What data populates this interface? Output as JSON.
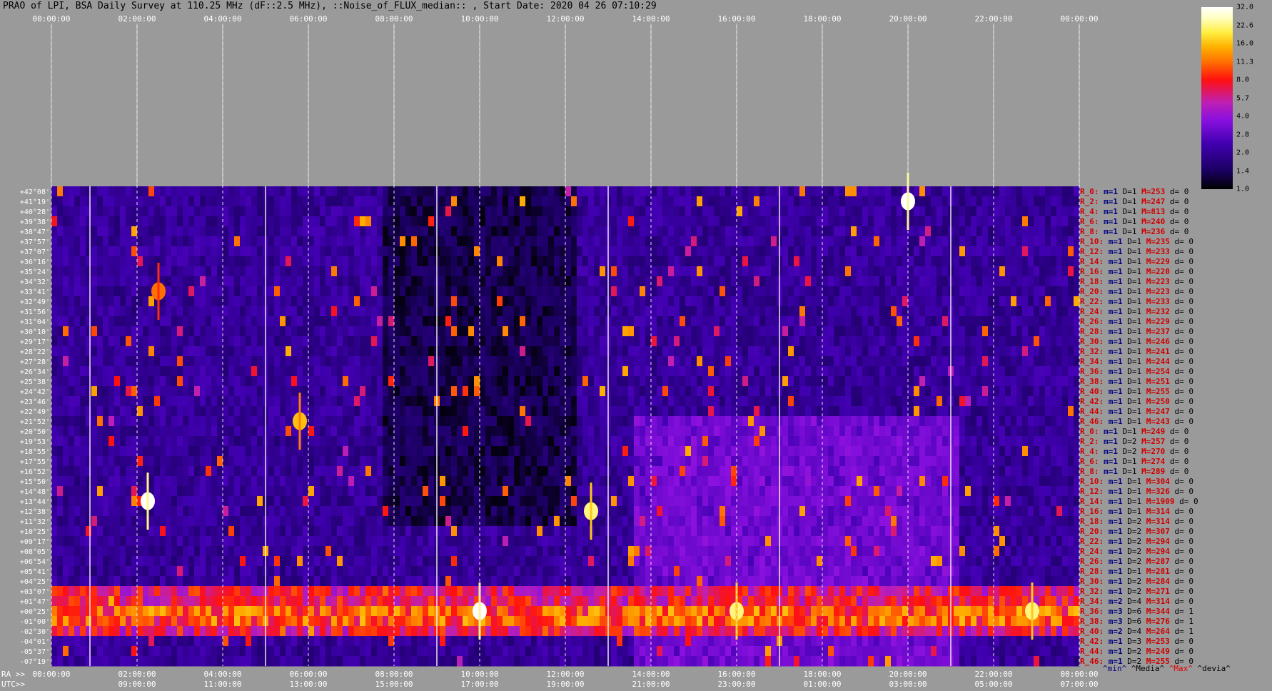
{
  "title": "PRAO of LPI, BSA Daily Survey at 110.25 MHz (dF::2.5 MHz), ::Noise_of_FLUX_median:: , Start Date: 2020 04 26 07:10:29",
  "chart_data": {
    "type": "heatmap",
    "title": "PRAO of LPI, BSA Daily Survey at 110.25 MHz (dF::2.5 MHz), ::Noise_of_FLUX_median:: , Start Date: 2020 04 26 07:10:29",
    "xlabel_ra": "RA >>",
    "xlabel_utc": "UTC>>",
    "x_ticks_ra_top": [
      "00:00:00",
      "02:00:00",
      "04:00:00",
      "06:00:00",
      "08:00:00",
      "10:00:00",
      "12:00:00",
      "14:00:00",
      "16:00:00",
      "18:00:00",
      "20:00:00",
      "22:00:00",
      "00:00:00"
    ],
    "x_ticks_ra_bottom": [
      "00:00:00",
      "02:00:00",
      "04:00:00",
      "06:00:00",
      "08:00:00",
      "10:00:00",
      "12:00:00",
      "14:00:00",
      "16:00:00",
      "18:00:00",
      "20:00:00",
      "22:00:00",
      "00:00:00"
    ],
    "x_ticks_utc": [
      "09:00:00",
      "11:00:00",
      "13:00:00",
      "15:00:00",
      "17:00:00",
      "19:00:00",
      "21:00:00",
      "23:00:00",
      "01:00:00",
      "03:00:00",
      "05:00:00",
      "07:00:00"
    ],
    "y_ticks": [
      "+42°08'",
      "+41°19'",
      "+40°28'",
      "+39°38'",
      "+38°47'",
      "+37°57'",
      "+37°07'",
      "+36°16'",
      "+35°24'",
      "+34°32'",
      "+33°41'",
      "+32°49'",
      "+31°56'",
      "+31°04'",
      "+30°10'",
      "+29°17'",
      "+28°22'",
      "+27°28'",
      "+26°34'",
      "+25°38'",
      "+24°42'",
      "+23°46'",
      "+22°49'",
      "+21°52'",
      "+20°50'",
      "+19°53'",
      "+18°55'",
      "+17°55'",
      "+16°52'",
      "+15°50'",
      "+14°48'",
      "+13°44'",
      "+12°38'",
      "+11°32'",
      "+10°25'",
      "+09°17'",
      "+08°05'",
      "+06°54'",
      "+05°41'",
      "+04°25'",
      "+03°07'",
      "+01°47'",
      "+00°25'",
      "-01°00'",
      "-02°30'",
      "-04°01'",
      "-05°37'",
      "-07°19'"
    ],
    "colorbar": {
      "ticks": [
        "32.0",
        "22.6",
        "16.0",
        "11.3",
        "8.0",
        "5.7",
        "4.0",
        "2.8",
        "2.0",
        "1.4",
        "1.0"
      ],
      "range": [
        1.0,
        32.0
      ],
      "scale": "log"
    },
    "bright_sources": [
      {
        "ra_h": 20.0,
        "dec": "+41°19'",
        "level": 32
      },
      {
        "ra_h": 2.25,
        "dec": "+13°44'",
        "level": 32
      },
      {
        "ra_h": 12.6,
        "dec": "+12°38'",
        "level": 22.6
      },
      {
        "ra_h": 5.8,
        "dec": "+21°52'",
        "level": 16
      },
      {
        "ra_h": 2.5,
        "dec": "+33°41'",
        "level": 11.3
      },
      {
        "ra_h": 16.0,
        "dec": "+00°25'",
        "level": 22.6
      },
      {
        "ra_h": 10.0,
        "dec": "+00°25'",
        "level": 32
      },
      {
        "ra_h": 22.9,
        "dec": "+00°25'",
        "level": 22.6
      }
    ],
    "row_stats": [
      {
        "label": "R_0:",
        "m": "m=1",
        "D": "D=1",
        "M": "M=253",
        "d": "d= 0"
      },
      {
        "label": "R_2:",
        "m": "m=1",
        "D": "D=1",
        "M": "M=247",
        "d": "d= 0"
      },
      {
        "label": "R_4:",
        "m": "m=1",
        "D": "D=1",
        "M": "M=813",
        "d": "d= 0"
      },
      {
        "label": "R_6:",
        "m": "m=1",
        "D": "D=1",
        "M": "M=240",
        "d": "d= 0"
      },
      {
        "label": "R_8:",
        "m": "m=1",
        "D": "D=1",
        "M": "M=236",
        "d": "d= 0"
      },
      {
        "label": "R_10:",
        "m": "m=1",
        "D": "D=1",
        "M": "M=235",
        "d": "d= 0"
      },
      {
        "label": "R_12:",
        "m": "m=1",
        "D": "D=1",
        "M": "M=233",
        "d": "d= 0"
      },
      {
        "label": "R_14:",
        "m": "m=1",
        "D": "D=1",
        "M": "M=229",
        "d": "d= 0"
      },
      {
        "label": "R_16:",
        "m": "m=1",
        "D": "D=1",
        "M": "M=220",
        "d": "d= 0"
      },
      {
        "label": "R_18:",
        "m": "m=1",
        "D": "D=1",
        "M": "M=223",
        "d": "d= 0"
      },
      {
        "label": "R_20:",
        "m": "m=1",
        "D": "D=1",
        "M": "M=223",
        "d": "d= 0"
      },
      {
        "label": "R_22:",
        "m": "m=1",
        "D": "D=1",
        "M": "M=233",
        "d": "d= 0"
      },
      {
        "label": "R_24:",
        "m": "m=1",
        "D": "D=1",
        "M": "M=232",
        "d": "d= 0"
      },
      {
        "label": "R_26:",
        "m": "m=1",
        "D": "D=1",
        "M": "M=229",
        "d": "d= 0"
      },
      {
        "label": "R_28:",
        "m": "m=1",
        "D": "D=1",
        "M": "M=237",
        "d": "d= 0"
      },
      {
        "label": "R_30:",
        "m": "m=1",
        "D": "D=1",
        "M": "M=246",
        "d": "d= 0"
      },
      {
        "label": "R_32:",
        "m": "m=1",
        "D": "D=1",
        "M": "M=241",
        "d": "d= 0"
      },
      {
        "label": "R_34:",
        "m": "m=1",
        "D": "D=1",
        "M": "M=244",
        "d": "d= 0"
      },
      {
        "label": "R_36:",
        "m": "m=1",
        "D": "D=1",
        "M": "M=254",
        "d": "d= 0"
      },
      {
        "label": "R_38:",
        "m": "m=1",
        "D": "D=1",
        "M": "M=251",
        "d": "d= 0"
      },
      {
        "label": "R_40:",
        "m": "m=1",
        "D": "D=1",
        "M": "M=255",
        "d": "d= 0"
      },
      {
        "label": "R_42:",
        "m": "m=1",
        "D": "D=1",
        "M": "M=250",
        "d": "d= 0"
      },
      {
        "label": "R_44:",
        "m": "m=1",
        "D": "D=1",
        "M": "M=247",
        "d": "d= 0"
      },
      {
        "label": "R_46:",
        "m": "m=1",
        "D": "D=1",
        "M": "M=243",
        "d": "d= 0"
      },
      {
        "label": "R_0:",
        "m": "m=1",
        "D": "D=1",
        "M": "M=249",
        "d": "d= 0"
      },
      {
        "label": "R_2:",
        "m": "m=1",
        "D": "D=2",
        "M": "M=257",
        "d": "d= 0"
      },
      {
        "label": "R_4:",
        "m": "m=1",
        "D": "D=2",
        "M": "M=270",
        "d": "d= 0"
      },
      {
        "label": "R_6:",
        "m": "m=1",
        "D": "D=1",
        "M": "M=274",
        "d": "d= 0"
      },
      {
        "label": "R_8:",
        "m": "m=1",
        "D": "D=1",
        "M": "M=289",
        "d": "d= 0"
      },
      {
        "label": "R_10:",
        "m": "m=1",
        "D": "D=1",
        "M": "M=304",
        "d": "d= 0"
      },
      {
        "label": "R_12:",
        "m": "m=1",
        "D": "D=1",
        "M": "M=326",
        "d": "d= 0"
      },
      {
        "label": "R_14:",
        "m": "m=1",
        "D": "D=1",
        "M": "M=1909",
        "d": "d= 0"
      },
      {
        "label": "R_16:",
        "m": "m=1",
        "D": "D=1",
        "M": "M=314",
        "d": "d= 0"
      },
      {
        "label": "R_18:",
        "m": "m=1",
        "D": "D=2",
        "M": "M=314",
        "d": "d= 0"
      },
      {
        "label": "R_20:",
        "m": "m=1",
        "D": "D=2",
        "M": "M=307",
        "d": "d= 0"
      },
      {
        "label": "R_22:",
        "m": "m=1",
        "D": "D=2",
        "M": "M=294",
        "d": "d= 0"
      },
      {
        "label": "R_24:",
        "m": "m=1",
        "D": "D=2",
        "M": "M=294",
        "d": "d= 0"
      },
      {
        "label": "R_26:",
        "m": "m=1",
        "D": "D=2",
        "M": "M=287",
        "d": "d= 0"
      },
      {
        "label": "R_28:",
        "m": "m=1",
        "D": "D=1",
        "M": "M=281",
        "d": "d= 0"
      },
      {
        "label": "R_30:",
        "m": "m=1",
        "D": "D=2",
        "M": "M=284",
        "d": "d= 0"
      },
      {
        "label": "R_32:",
        "m": "m=1",
        "D": "D=2",
        "M": "M=271",
        "d": "d= 0"
      },
      {
        "label": "R_34:",
        "m": "m=2",
        "D": "D=4",
        "M": "M=314",
        "d": "d= 0"
      },
      {
        "label": "R_36:",
        "m": "m=3",
        "D": "D=6",
        "M": "M=344",
        "d": "d= 1"
      },
      {
        "label": "R_38:",
        "m": "m=3",
        "D": "D=6",
        "M": "M=276",
        "d": "d= 1"
      },
      {
        "label": "R_40:",
        "m": "m=2",
        "D": "D=4",
        "M": "M=264",
        "d": "d= 1"
      },
      {
        "label": "R_42:",
        "m": "m=1",
        "D": "D=3",
        "M": "M=253",
        "d": "d= 0"
      },
      {
        "label": "R_44:",
        "m": "m=1",
        "D": "D=2",
        "M": "M=249",
        "d": "d= 0"
      },
      {
        "label": "R_46:",
        "m": "m=1",
        "D": "D=2",
        "M": "M=255",
        "d": "d= 0"
      }
    ],
    "footer": {
      "min": "^min^",
      "median": "^Media^",
      "max": "^Max^",
      "dev": "^devia^"
    }
  }
}
